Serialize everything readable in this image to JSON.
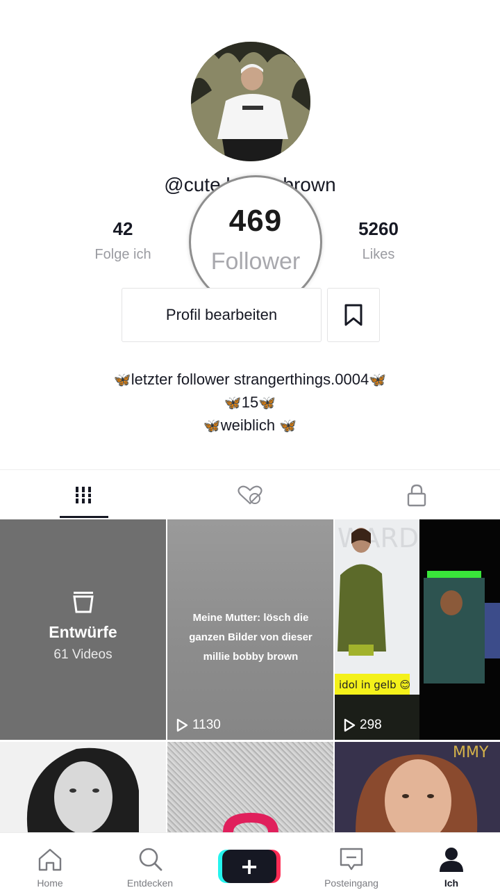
{
  "profile": {
    "username": "@cute.bobby.brown",
    "following_count": "42",
    "following_label": "Folge ich",
    "followers_count": "469",
    "followers_label": "Follower",
    "likes_count": "5260",
    "likes_label": "Likes",
    "edit_button_label": "Profil bearbeiten"
  },
  "bio": {
    "line1": "letzter follower strangerthings.0004",
    "line2": "15",
    "line3": "weiblich",
    "emoji": "🦋"
  },
  "tabs": {
    "active": "videos",
    "items": [
      {
        "name": "videos",
        "icon": "grid-icon"
      },
      {
        "name": "liked",
        "icon": "heart-hidden-icon"
      },
      {
        "name": "private",
        "icon": "lock-icon"
      }
    ]
  },
  "grid": {
    "drafts_title": "Entwürfe",
    "drafts_count": "61 Videos",
    "video1_caption": "Meine Mutter: lösch die ganzen Bilder von dieser millie bobby brown",
    "video1_plays": "1130",
    "video2_plays": "298",
    "video2_sticker": "idol in gelb 😊"
  },
  "nav": {
    "home": "Home",
    "discover": "Entdecken",
    "inbox": "Posteingang",
    "me": "Ich",
    "create_symbol": "+"
  },
  "colors": {
    "text": "#161823",
    "secondary": "#9a9ba1",
    "accent_pink": "#fe2c55",
    "accent_cyan": "#25f4ee"
  }
}
